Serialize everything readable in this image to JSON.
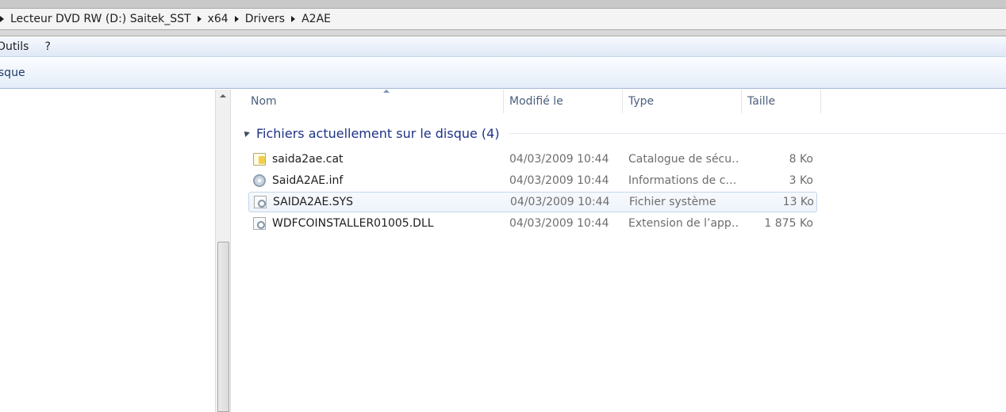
{
  "breadcrumb": {
    "items": [
      {
        "label": "Lecteur DVD RW (D:) Saitek_SST"
      },
      {
        "label": "x64"
      },
      {
        "label": "Drivers"
      },
      {
        "label": "A2AE"
      }
    ]
  },
  "menu": {
    "items": [
      {
        "label": "Outils"
      },
      {
        "label": "?"
      }
    ]
  },
  "command_bar": {
    "item_label": "isque"
  },
  "columns": {
    "name": "Nom",
    "modified": "Modifié le",
    "type": "Type",
    "size": "Taille"
  },
  "group": {
    "title": "Fichiers actuellement sur le disque (4)"
  },
  "files": [
    {
      "name": "saida2ae.cat",
      "modified": "04/03/2009 10:44",
      "type": "Catalogue de sécu…",
      "size": "8 Ko",
      "icon": "catalog-file-icon"
    },
    {
      "name": "SaidA2AE.inf",
      "modified": "04/03/2009 10:44",
      "type": "Informations de c…",
      "size": "3 Ko",
      "icon": "setup-info-file-icon"
    },
    {
      "name": "SAIDA2AE.SYS",
      "modified": "04/03/2009 10:44",
      "type": "Fichier système",
      "size": "13 Ko",
      "icon": "system-file-icon",
      "selected": true
    },
    {
      "name": "WDFCOINSTALLER01005.DLL",
      "modified": "04/03/2009 10:44",
      "type": "Extension de l’app…",
      "size": "1 875 Ko",
      "icon": "dll-file-icon"
    }
  ]
}
